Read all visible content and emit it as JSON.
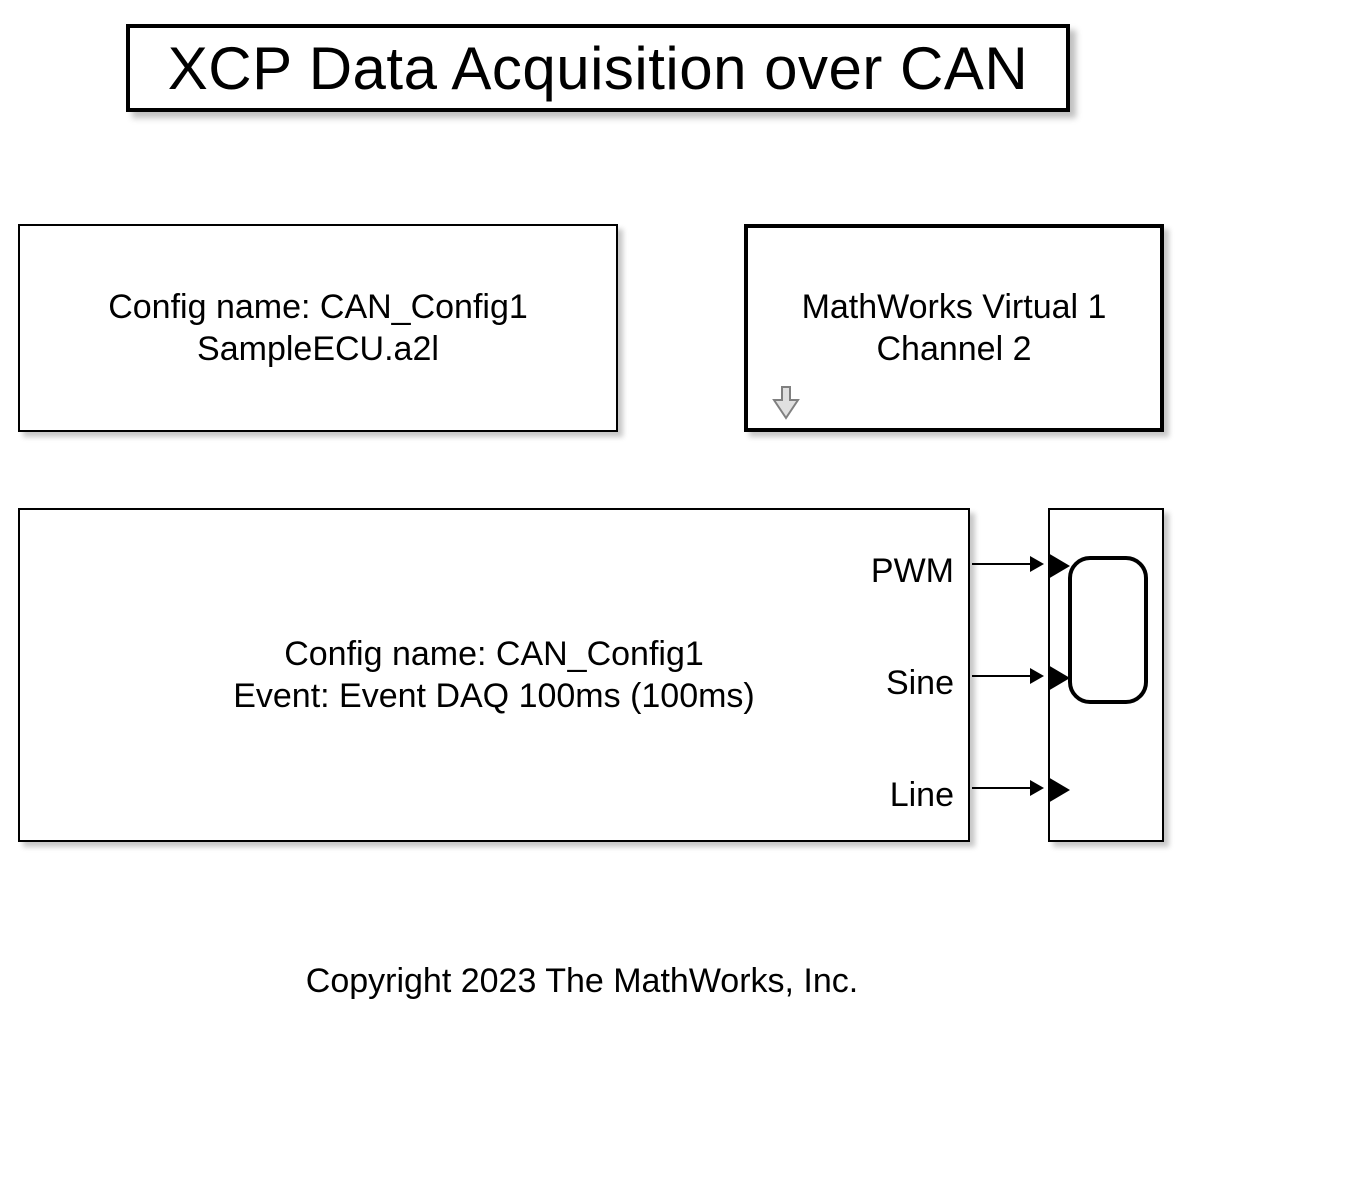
{
  "title": "XCP Data Acquisition over CAN",
  "config_block": {
    "line1": "Config name: CAN_Config1",
    "line2": "SampleECU.a2l"
  },
  "transport_block": {
    "line1": "MathWorks Virtual 1",
    "line2": "Channel 2"
  },
  "daq_block": {
    "line1": "Config name: CAN_Config1",
    "line2": "Event: Event DAQ 100ms (100ms)",
    "ports": {
      "p1": "PWM",
      "p2": "Sine",
      "p3": "Line"
    }
  },
  "copyright": "Copyright 2023 The MathWorks, Inc."
}
